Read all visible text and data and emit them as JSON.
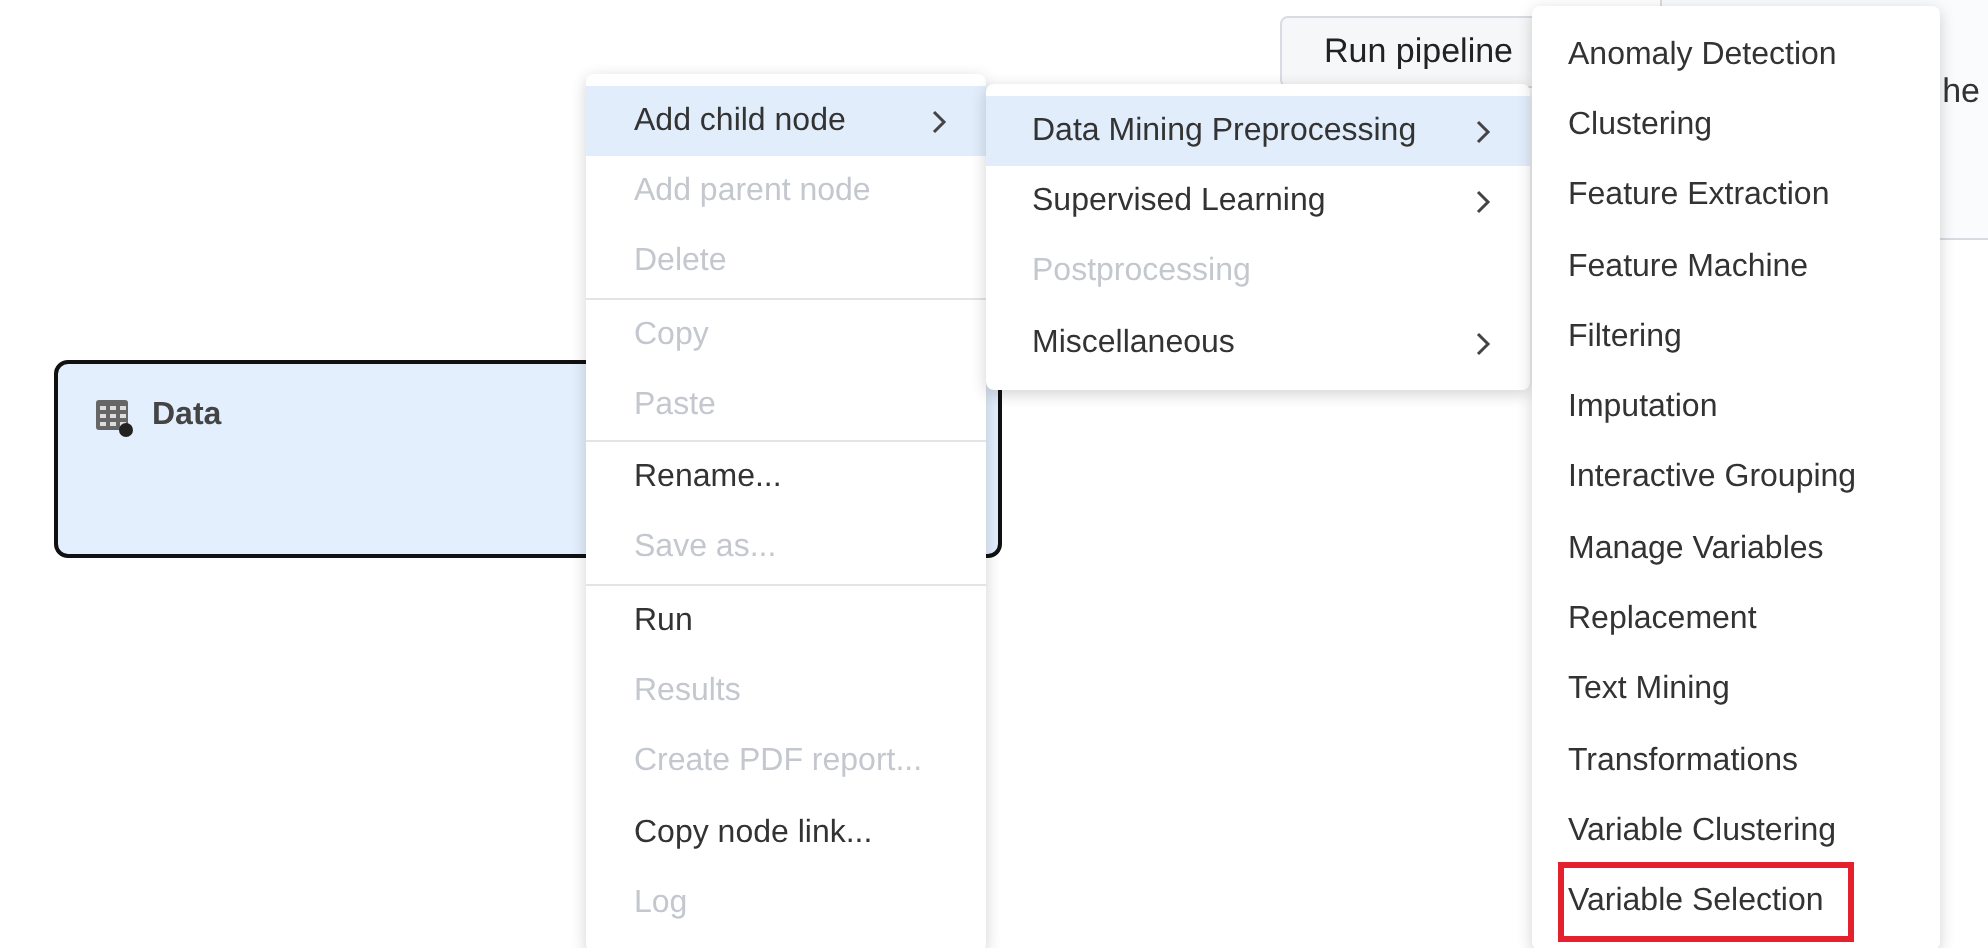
{
  "toolbar": {
    "run_button": "Run pipeline"
  },
  "side_panel": {
    "text": "he"
  },
  "node": {
    "title": "Data",
    "selected": true
  },
  "context_menu": {
    "groups": [
      [
        {
          "label": "Add child node",
          "disabled": false,
          "selected": true,
          "submenu": true
        },
        {
          "label": "Add parent node",
          "disabled": true,
          "selected": false,
          "submenu": false
        },
        {
          "label": "Delete",
          "disabled": true,
          "selected": false,
          "submenu": false
        }
      ],
      [
        {
          "label": "Copy",
          "disabled": true,
          "selected": false,
          "submenu": false
        },
        {
          "label": "Paste",
          "disabled": true,
          "selected": false,
          "submenu": false
        }
      ],
      [
        {
          "label": "Rename...",
          "disabled": false,
          "selected": false,
          "submenu": false
        },
        {
          "label": "Save as...",
          "disabled": true,
          "selected": false,
          "submenu": false
        }
      ],
      [
        {
          "label": "Run",
          "disabled": false,
          "selected": false,
          "submenu": false
        },
        {
          "label": "Results",
          "disabled": true,
          "selected": false,
          "submenu": false
        },
        {
          "label": "Create PDF report...",
          "disabled": true,
          "selected": false,
          "submenu": false
        },
        {
          "label": "Copy node link...",
          "disabled": false,
          "selected": false,
          "submenu": false
        },
        {
          "label": "Log",
          "disabled": true,
          "selected": false,
          "submenu": false
        }
      ]
    ]
  },
  "submenu": {
    "items": [
      {
        "label": "Data Mining Preprocessing",
        "disabled": false,
        "selected": true,
        "submenu": true
      },
      {
        "label": "Supervised Learning",
        "disabled": false,
        "selected": false,
        "submenu": true
      },
      {
        "label": "Postprocessing",
        "disabled": true,
        "selected": false,
        "submenu": false
      },
      {
        "label": "Miscellaneous",
        "disabled": false,
        "selected": false,
        "submenu": true
      }
    ]
  },
  "node_menu": {
    "items": [
      {
        "label": "Anomaly Detection",
        "highlighted": false
      },
      {
        "label": "Clustering",
        "highlighted": false
      },
      {
        "label": "Feature Extraction",
        "highlighted": false
      },
      {
        "label": "Feature Machine",
        "highlighted": false
      },
      {
        "label": "Filtering",
        "highlighted": false
      },
      {
        "label": "Imputation",
        "highlighted": false
      },
      {
        "label": "Interactive Grouping",
        "highlighted": false
      },
      {
        "label": "Manage Variables",
        "highlighted": false
      },
      {
        "label": "Replacement",
        "highlighted": false
      },
      {
        "label": "Text Mining",
        "highlighted": false
      },
      {
        "label": "Transformations",
        "highlighted": false
      },
      {
        "label": "Variable Clustering",
        "highlighted": false
      },
      {
        "label": "Variable Selection",
        "highlighted": true
      }
    ]
  }
}
